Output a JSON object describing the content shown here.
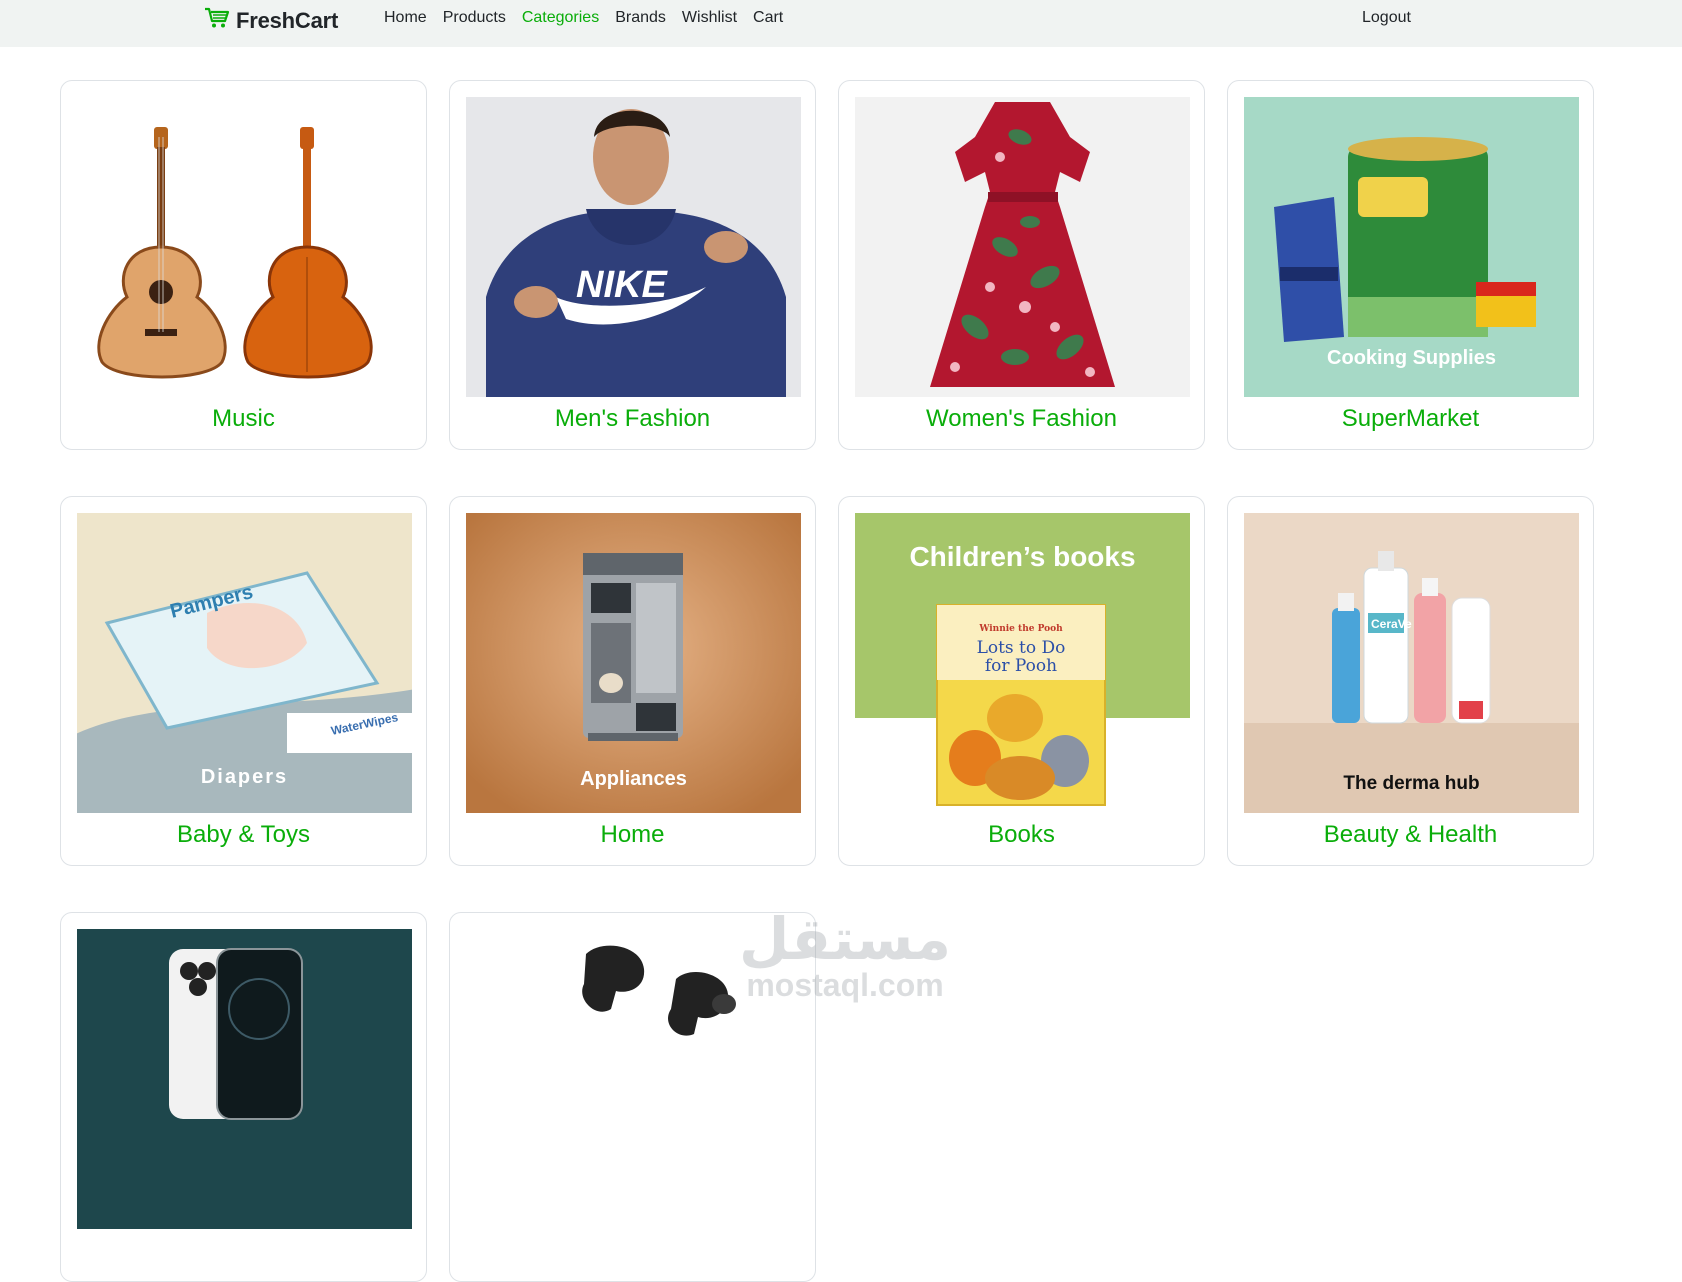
{
  "brand": {
    "name": "FreshCart",
    "icon": "cart-icon",
    "accent": "#0aad0a"
  },
  "nav": {
    "links": [
      {
        "label": "Home",
        "active": false
      },
      {
        "label": "Products",
        "active": false
      },
      {
        "label": "Categories",
        "active": true
      },
      {
        "label": "Brands",
        "active": false
      },
      {
        "label": "Wishlist",
        "active": false
      },
      {
        "label": "Cart",
        "active": false
      }
    ],
    "logout": "Logout"
  },
  "categories": [
    {
      "name": "Music",
      "image_caption": ""
    },
    {
      "name": "Men's Fashion",
      "image_caption": ""
    },
    {
      "name": "Women's Fashion",
      "image_caption": ""
    },
    {
      "name": "SuperMarket",
      "image_caption": "Cooking Supplies"
    },
    {
      "name": "Baby & Toys",
      "image_caption": "Diapers"
    },
    {
      "name": "Home",
      "image_caption": "Appliances"
    },
    {
      "name": "Books",
      "image_caption": "Children’s books"
    },
    {
      "name": "Beauty & Health",
      "image_caption": "The derma hub"
    },
    {
      "name": "",
      "image_caption": ""
    },
    {
      "name": "",
      "image_caption": ""
    }
  ],
  "watermark": {
    "arabic": "مستقل",
    "latin": "mostaql.com"
  }
}
